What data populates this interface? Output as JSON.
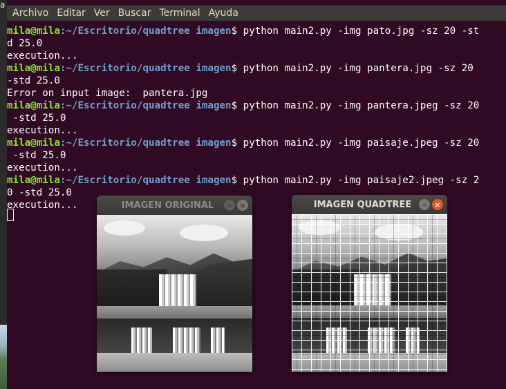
{
  "desktop": {
    "edge_letter": "a"
  },
  "menubar": {
    "items": [
      "Archivo",
      "Editar",
      "Ver",
      "Buscar",
      "Terminal",
      "Ayuda"
    ]
  },
  "terminal": {
    "user": "mila@mila",
    "path": ":~/Escritorio/quadtree imagen",
    "prompt_char": "$",
    "lines": [
      {
        "type": "cmd",
        "text": " python main2.py -img pato.jpg -sz 20 -st"
      },
      {
        "type": "out",
        "text": "d 25.0"
      },
      {
        "type": "out",
        "text": "execution..."
      },
      {
        "type": "cmd",
        "text": " python main2.py -img pantera.jpg -sz 20"
      },
      {
        "type": "out",
        "text": "-std 25.0"
      },
      {
        "type": "out",
        "text": "Error on input image:  pantera.jpg"
      },
      {
        "type": "cmd",
        "text": " python main2.py -img pantera.jpeg -sz 20"
      },
      {
        "type": "out",
        "text": " -std 25.0"
      },
      {
        "type": "out",
        "text": "execution..."
      },
      {
        "type": "cmd",
        "text": " python main2.py -img paisaje.jpeg -sz 20"
      },
      {
        "type": "out",
        "text": " -std 25.0"
      },
      {
        "type": "out",
        "text": "execution..."
      },
      {
        "type": "cmd",
        "text": " python main2.py -img paisaje2.jpeg -sz 2"
      },
      {
        "type": "out",
        "text": "0 -std 25.0"
      },
      {
        "type": "out",
        "text": "execution..."
      }
    ]
  },
  "windows": {
    "original": {
      "title": "IMAGEN ORIGINAL",
      "min": "–",
      "close": "×"
    },
    "quadtree": {
      "title": "IMAGEN QUADTREE",
      "min": "–",
      "close": "×"
    }
  },
  "colors": {
    "terminal_bg": "#300a24",
    "user": "#8ae234",
    "path": "#729fcf",
    "close_active": "#e95420"
  }
}
